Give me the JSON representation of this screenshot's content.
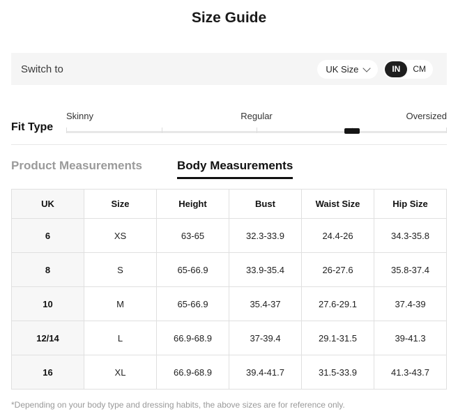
{
  "title": "Size Guide",
  "switch_bar": {
    "label": "Switch to",
    "size_system": {
      "selected": "UK Size"
    },
    "unit_toggle": {
      "in": "IN",
      "cm": "CM",
      "selected": "IN"
    }
  },
  "fit_type": {
    "label": "Fit Type",
    "options": {
      "left": "Skinny",
      "center": "Regular",
      "right": "Oversized"
    },
    "slider_percent": 75
  },
  "tabs": {
    "product": "Product Measurements",
    "body": "Body Measurements",
    "active": "Body Measurements"
  },
  "table": {
    "headers": [
      "UK",
      "Size",
      "Height",
      "Bust",
      "Waist Size",
      "Hip Size"
    ],
    "rows": [
      [
        "6",
        "XS",
        "63-65",
        "32.3-33.9",
        "24.4-26",
        "34.3-35.8"
      ],
      [
        "8",
        "S",
        "65-66.9",
        "33.9-35.4",
        "26-27.6",
        "35.8-37.4"
      ],
      [
        "10",
        "M",
        "65-66.9",
        "35.4-37",
        "27.6-29.1",
        "37.4-39"
      ],
      [
        "12/14",
        "L",
        "66.9-68.9",
        "37-39.4",
        "29.1-31.5",
        "39-41.3"
      ],
      [
        "16",
        "XL",
        "66.9-68.9",
        "39.4-41.7",
        "31.5-33.9",
        "41.3-43.7"
      ]
    ]
  },
  "footnote": "*Depending on your body type and dressing habits, the above sizes are for reference only.",
  "colors": {
    "accent_dark": "#1f1f1f",
    "bar_background": "#f5f5f5",
    "first_column_background": "#f7f7f7",
    "table_border": "#e0e0e0",
    "inactive_tab": "#9a9a9a",
    "footnote_text": "#999999"
  }
}
